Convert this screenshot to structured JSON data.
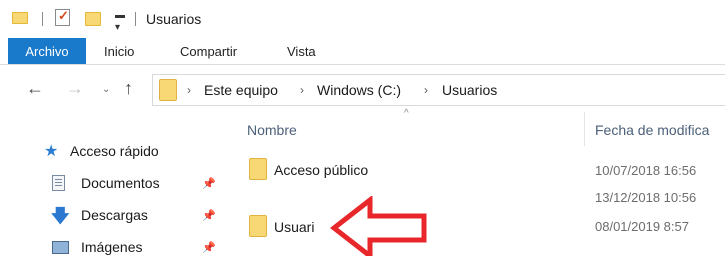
{
  "window": {
    "title": "Usuarios"
  },
  "ribbon": {
    "tabs": [
      "Archivo",
      "Inicio",
      "Compartir",
      "Vista"
    ]
  },
  "address": {
    "breadcrumbs": [
      "Este equipo",
      "Windows (C:)",
      "Usuarios"
    ]
  },
  "sidebar": {
    "quick_access": "Acceso rápido",
    "items": [
      {
        "label": "Documentos",
        "icon": "document-icon"
      },
      {
        "label": "Descargas",
        "icon": "download-arrow-icon"
      },
      {
        "label": "Imágenes",
        "icon": "image-icon"
      }
    ]
  },
  "list": {
    "columns": {
      "name": "Nombre",
      "date": "Fecha de modifica"
    },
    "rows": [
      {
        "name": "Acceso público",
        "date": "10/07/2018 16:56"
      },
      {
        "name": "",
        "date": "13/12/2018 10:56"
      },
      {
        "name": "Usuari",
        "date": "08/01/2019 8:57"
      }
    ]
  },
  "annotation": {
    "arrow_color": "#e8272a"
  }
}
